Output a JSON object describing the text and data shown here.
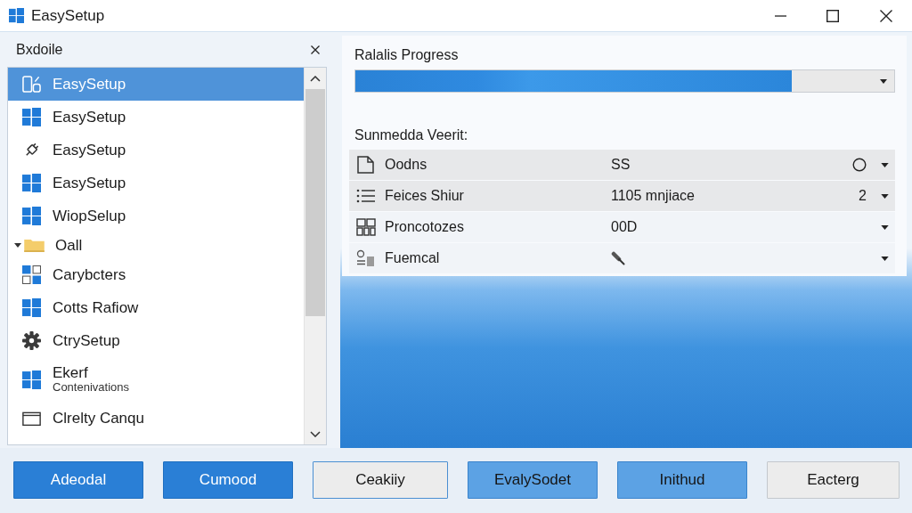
{
  "window": {
    "title": "EasySetup"
  },
  "sidebar": {
    "title": "Bxdoile",
    "items": [
      {
        "kind": "item",
        "label": "EasySetup",
        "selected": true
      },
      {
        "kind": "item",
        "label": "EasySetup",
        "selected": false
      },
      {
        "kind": "item",
        "label": "EasySetup",
        "selected": false
      },
      {
        "kind": "item",
        "label": "EasySetup",
        "selected": false
      },
      {
        "kind": "item",
        "label": "WiopSelup",
        "selected": false
      },
      {
        "kind": "group",
        "label": "Oall",
        "expanded": true,
        "selected": false
      },
      {
        "kind": "item",
        "label": "Carybcters",
        "selected": false
      },
      {
        "kind": "item",
        "label": "Cotts Rafiow",
        "selected": false
      },
      {
        "kind": "item",
        "label": "CtrySetup",
        "selected": false
      },
      {
        "kind": "item",
        "label": "Ekerf",
        "subtitle": "Contenivations",
        "selected": false
      },
      {
        "kind": "item",
        "label": "Clrelty Canqu",
        "selected": false
      }
    ]
  },
  "progress": {
    "label": "Ralalis Progress",
    "level": 0.81
  },
  "summary": {
    "label": "Sunmedda Veerit:",
    "rows": [
      {
        "name": "Oodns",
        "value": "SS",
        "selected": true
      },
      {
        "name": "Feices Shiur",
        "value": "1105 mnjiace",
        "extra": "2",
        "selected": true
      },
      {
        "name": "Proncotozes",
        "value": "00D",
        "selected": false
      },
      {
        "name": "Fuemcal",
        "selected": false
      }
    ]
  },
  "buttons": [
    {
      "label": "Adeodal",
      "kind": "primary"
    },
    {
      "label": "Cumood",
      "kind": "primary"
    },
    {
      "label": "Ceakiiy",
      "kind": "outline"
    },
    {
      "label": "EvalySodet",
      "kind": "light"
    },
    {
      "label": "Inithud",
      "kind": "light"
    },
    {
      "label": "Eacterg",
      "kind": "default"
    }
  ]
}
